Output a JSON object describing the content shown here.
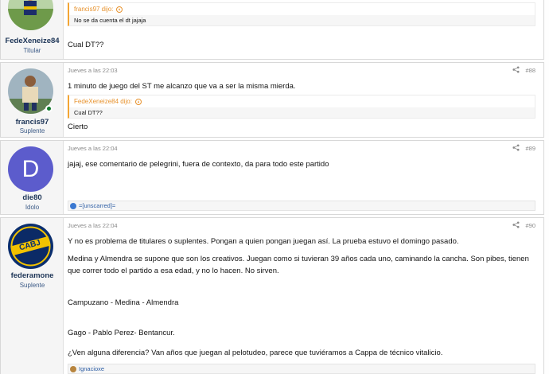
{
  "posts": [
    {
      "username": "FedeXeneize84",
      "user_title": "Titular",
      "quote_author": "francis97 dijo:",
      "quote_text": "No se da cuenta el dt jajaja",
      "text": "Cual DT??"
    },
    {
      "timestamp": "Jueves a las 22:03",
      "number": "#88",
      "username": "francis97",
      "user_title": "Suplente",
      "text": "1 minuto de juego del ST me alcanzo que va a ser la misma mierda.",
      "quote_author": "FedeXeneize84 dijo:",
      "quote_text": "Cual DT??",
      "text2": "Cierto"
    },
    {
      "timestamp": "Jueves a las 22:04",
      "number": "#89",
      "username": "die80",
      "user_title": "Idolo",
      "avatar_letter": "D",
      "avatar_color": "#5c5ccc",
      "text": "jajaj, ese comentario de pelegrini, fuera de contexto, da para todo este partido",
      "reaction": "=[unscarred]="
    },
    {
      "timestamp": "Jueves a las 22:04",
      "number": "#90",
      "username": "federamone",
      "user_title": "Suplente",
      "avatar_text": "CABJ",
      "paragraphs": [
        "Y no es problema de titulares o suplentes. Pongan a quien pongan juegan así. La prueba estuvo el domingo pasado.",
        "Medina y Almendra se supone que son los creativos. Juegan como si tuvieran 39 años cada uno, caminando la cancha. Son pibes, tienen",
        "que correr todo el partido a esa edad, y no lo hacen. No sirven.",
        "Campuzano - Medina - Almendra",
        "Gago - Pablo Perez- Bentancur.",
        "¿Ven alguna diferencia? Van años que juegan al pelotudeo, parece que tuviéramos a Cappa de técnico vitalicio."
      ],
      "reaction": "Ignacioxe"
    }
  ]
}
